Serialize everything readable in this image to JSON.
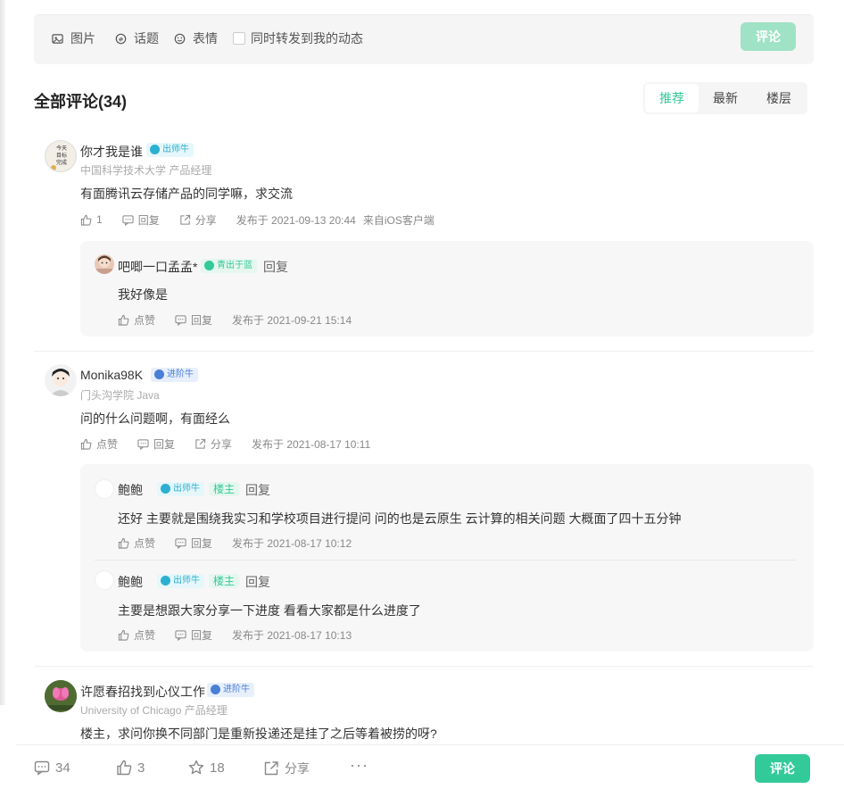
{
  "composer": {
    "image_label": "图片",
    "topic_label": "话题",
    "emoji_label": "表情",
    "forward_label": "同时转发到我的动态",
    "submit_label": "评论"
  },
  "comments_header": {
    "title": "全部评论(34)",
    "tabs": [
      {
        "label": "推荐",
        "active": true
      },
      {
        "label": "最新",
        "active": false
      },
      {
        "label": "楼层",
        "active": false
      }
    ]
  },
  "comments": [
    {
      "name": "你才我是谁",
      "badge": "出师牛",
      "subtitle": "中国科学技术大学 产品经理",
      "text": "有面腾讯云存储产品的同学嘛，求交流",
      "likes": "1",
      "reply_label": "回复",
      "share_label": "分享",
      "time": "发布于 2021-09-13 20:44",
      "source": "来自iOS客户端",
      "replies": [
        {
          "name": "吧唧一口孟孟*",
          "badge": "青出于蓝",
          "reply_link": "回复",
          "text": "我好像是",
          "like_label": "点赞",
          "reply_label": "回复",
          "time": "发布于 2021-09-21 15:14"
        }
      ]
    },
    {
      "name": "Monika98K",
      "badge": "进阶牛",
      "subtitle": "门头沟学院 Java",
      "text": "问的什么问题啊，有面经么",
      "like_label": "点赞",
      "reply_label": "回复",
      "share_label": "分享",
      "time": "发布于 2021-08-17 10:11",
      "replies": [
        {
          "name": "鲍鲍",
          "badge": "出师牛",
          "owner_tag": "楼主",
          "reply_link": "回复",
          "text": "还好 主要就是围绕我实习和学校项目进行提问 问的也是云原生 云计算的相关问题 大概面了四十五分钟",
          "like_label": "点赞",
          "reply_label": "回复",
          "time": "发布于 2021-08-17 10:12"
        },
        {
          "name": "鲍鲍",
          "badge": "出师牛",
          "owner_tag": "楼主",
          "reply_link": "回复",
          "text": "主要是想跟大家分享一下进度 看看大家都是什么进度了",
          "like_label": "点赞",
          "reply_label": "回复",
          "time": "发布于 2021-08-17 10:13"
        }
      ]
    },
    {
      "name": "许愿春招找到心仪工作",
      "badge": "进阶牛",
      "subtitle": "University of Chicago 产品经理",
      "text": "楼主，求问你换不同部门是重新投递还是挂了之后等着被捞的呀?"
    }
  ],
  "bottom_bar": {
    "comments_count": "34",
    "likes_count": "3",
    "favorites_count": "18",
    "share_label": "分享",
    "more_label": "···",
    "submit_label": "评论"
  },
  "colors": {
    "accent": "#32ca99",
    "accent_light": "#9fe2c6",
    "badge_teal": "#2cb0d1",
    "badge_blue": "#4a7fd6"
  }
}
